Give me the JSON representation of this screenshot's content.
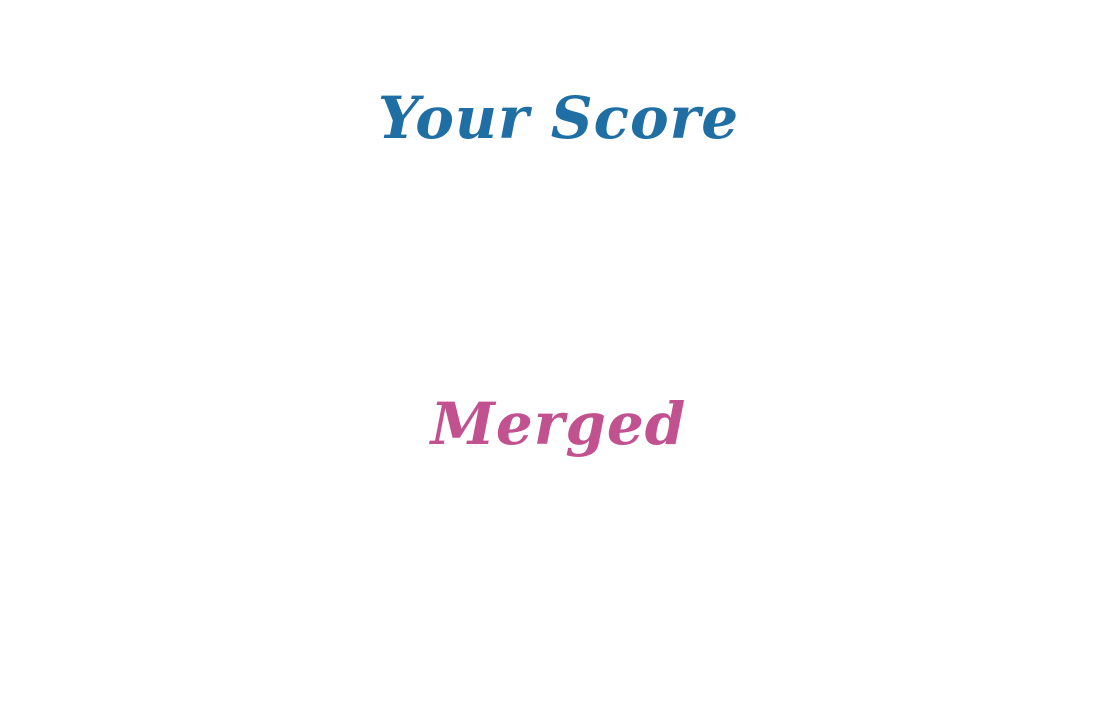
{
  "score_screen": {
    "title": "Your Score",
    "result_label": "Merged"
  },
  "colors": {
    "background": "#ffffff",
    "title": "#1f6fa5",
    "result_label": "#c2528f"
  }
}
